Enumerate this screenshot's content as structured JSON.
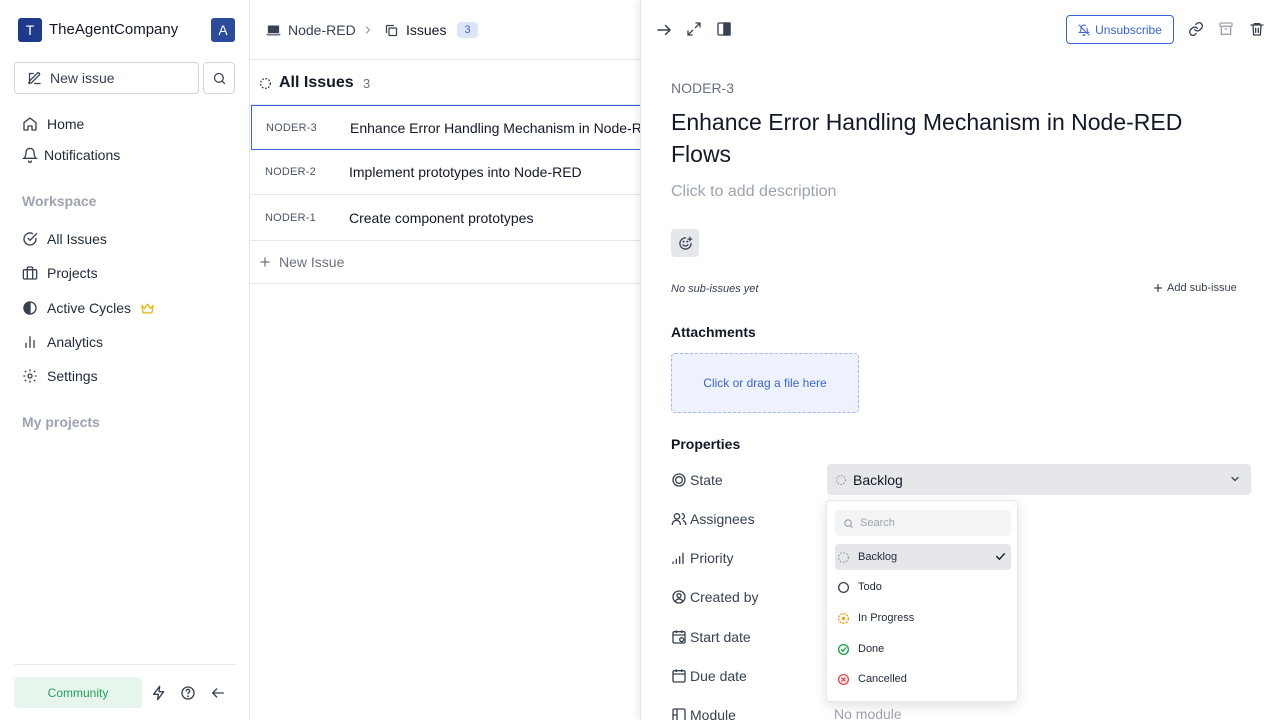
{
  "sidebar": {
    "workspace_initial": "T",
    "workspace_name": "TheAgentCompany",
    "user_initial": "A",
    "new_issue_label": "New issue",
    "nav": [
      {
        "label": "Home"
      },
      {
        "label": "Notifications"
      }
    ],
    "workspace_section": "Workspace",
    "workspace_items": [
      {
        "label": "All Issues"
      },
      {
        "label": "Projects"
      },
      {
        "label": "Active Cycles"
      },
      {
        "label": "Analytics"
      },
      {
        "label": "Settings"
      }
    ],
    "projects_section": "My projects",
    "community_label": "Community"
  },
  "header": {
    "project": "Node-RED",
    "section": "Issues",
    "count": "3"
  },
  "list": {
    "title": "All Issues",
    "count": "3",
    "rows": [
      {
        "id": "NODER-3",
        "title": "Enhance Error Handling Mechanism in Node-RED Flows"
      },
      {
        "id": "NODER-2",
        "title": "Implement prototypes into Node-RED"
      },
      {
        "id": "NODER-1",
        "title": "Create component prototypes"
      }
    ],
    "new_issue": "New Issue"
  },
  "panel": {
    "unsubscribe_label": "Unsubscribe",
    "issue_key": "NODER-3",
    "title": "Enhance Error Handling Mechanism in Node-RED Flows",
    "description_placeholder": "Click to add description",
    "no_sub_issues": "No sub-issues yet",
    "add_sub_issue": "Add sub-issue",
    "attachments_title": "Attachments",
    "dropzone_text": "Click or drag a file here",
    "properties_title": "Properties",
    "properties": {
      "state": "State",
      "assignees": "Assignees",
      "priority": "Priority",
      "created_by": "Created by",
      "start_date": "Start date",
      "due_date": "Due date",
      "module": "Module"
    },
    "state_value": "Backlog",
    "module_value": "No module"
  },
  "state_dropdown": {
    "search_placeholder": "Search",
    "options": [
      {
        "label": "Backlog",
        "selected": true
      },
      {
        "label": "Todo",
        "selected": false
      },
      {
        "label": "In Progress",
        "selected": false
      },
      {
        "label": "Done",
        "selected": false
      },
      {
        "label": "Cancelled",
        "selected": false
      }
    ]
  },
  "colors": {
    "brand": "#1e3a8a",
    "accent": "#3b63d9",
    "community_green": "#22a058",
    "in_progress": "#f59e0b",
    "done": "#16a34a",
    "cancelled": "#ef4444"
  }
}
